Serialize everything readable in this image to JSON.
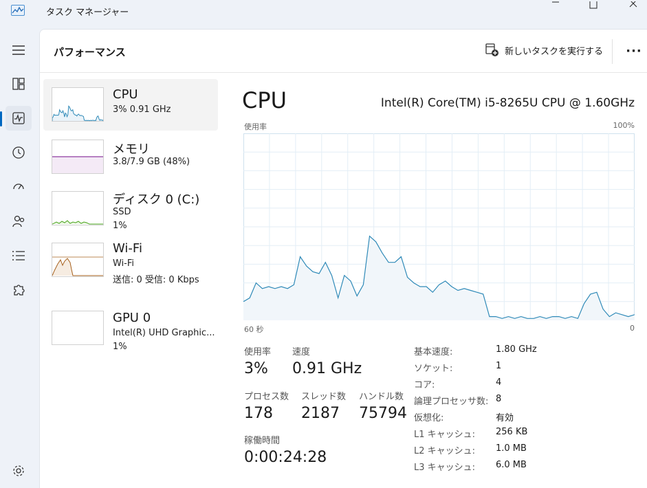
{
  "window": {
    "title": "タスク マネージャー"
  },
  "header": {
    "title": "パフォーマンス",
    "run_task": "新しいタスクを実行する"
  },
  "devices": [
    {
      "name": "CPU",
      "line1": "3%  0.91 GHz"
    },
    {
      "name": "メモリ",
      "line1": "3.8/7.9 GB (48%)"
    },
    {
      "name": "ディスク 0 (C:)",
      "line1": "SSD",
      "line2": "1%"
    },
    {
      "name": "Wi-Fi",
      "line1": "Wi-Fi",
      "line2": "送信: 0  受信: 0 Kbps"
    },
    {
      "name": "GPU 0",
      "line1": "Intel(R) UHD Graphic...",
      "line2": "1%"
    }
  ],
  "detail": {
    "title": "CPU",
    "model": "Intel(R) Core(TM) i5-8265U CPU @ 1.60GHz",
    "graph": {
      "top_left": "使用率",
      "top_right": "100%",
      "bottom_left": "60 秒",
      "bottom_right": "0",
      "usage_values": [
        10,
        12,
        20,
        17,
        18,
        17,
        18,
        17,
        19,
        34,
        29,
        26,
        25,
        31,
        24,
        12,
        24,
        21,
        13,
        19,
        45,
        42,
        36,
        31,
        31,
        34,
        23,
        20,
        18,
        18,
        15,
        19,
        21,
        18,
        16,
        17,
        16,
        15,
        14,
        2,
        2,
        1,
        2,
        1,
        2,
        1,
        1,
        2,
        1,
        2,
        2,
        1,
        2,
        1,
        9,
        14,
        15,
        6,
        2,
        4,
        3,
        2,
        3
      ]
    },
    "stats": {
      "usage_label": "使用率",
      "usage_value": "3%",
      "speed_label": "速度",
      "speed_value": "0.91 GHz",
      "process_label": "プロセス数",
      "process_value": "178",
      "thread_label": "スレッド数",
      "thread_value": "2187",
      "handle_label": "ハンドル数",
      "handle_value": "75794",
      "uptime_label": "稼働時間",
      "uptime_value": "0:00:24:28"
    },
    "specs": [
      {
        "label": "基本速度:",
        "value": "1.80 GHz"
      },
      {
        "label": "ソケット:",
        "value": "1"
      },
      {
        "label": "コア:",
        "value": "4"
      },
      {
        "label": "論理プロセッサ数:",
        "value": "8"
      },
      {
        "label": "仮想化:",
        "value": "有効"
      },
      {
        "label": "L1 キャッシュ:",
        "value": "256 KB"
      },
      {
        "label": "L2 キャッシュ:",
        "value": "1.0 MB"
      },
      {
        "label": "L3 キャッシュ:",
        "value": "6.0 MB"
      }
    ]
  },
  "colors": {
    "cpu_line": "#2f8ab8",
    "cpu_fill": "#f1f6fa",
    "memory": "#8e3ba0",
    "disk": "#4aa41c",
    "wifi": "#a7621e",
    "accent": "#0067c0"
  }
}
